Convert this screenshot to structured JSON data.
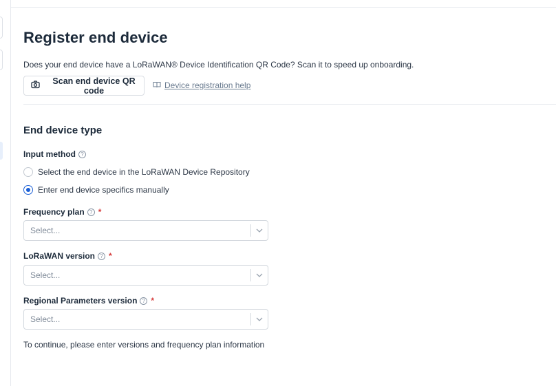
{
  "page": {
    "title": "Register end device",
    "intro": "Does your end device have a LoRaWAN® Device Identification QR Code? Scan it to speed up onboarding.",
    "scan_button_label": "Scan end device QR code",
    "help_link_label": "Device registration help"
  },
  "section": {
    "title": "End device type",
    "input_method": {
      "label": "Input method",
      "options": [
        {
          "label": "Select the end device in the LoRaWAN Device Repository",
          "selected": false
        },
        {
          "label": "Enter end device specifics manually",
          "selected": true
        }
      ]
    },
    "fields": [
      {
        "label": "Frequency plan",
        "required_mark": "*",
        "placeholder": "Select..."
      },
      {
        "label": "LoRaWAN version",
        "required_mark": "*",
        "placeholder": "Select..."
      },
      {
        "label": "Regional Parameters version",
        "required_mark": "*",
        "placeholder": "Select..."
      }
    ],
    "note": "To continue, please enter versions and frequency plan information"
  },
  "colors": {
    "accent": "#1a5fd6",
    "required": "#d63a3a",
    "text": "#1c2a3a",
    "border": "#d3d8de"
  },
  "icons": {
    "scan": "camera-icon",
    "help_link": "book-icon",
    "field_help": "question-circle-icon",
    "select": "chevron-down-icon"
  }
}
